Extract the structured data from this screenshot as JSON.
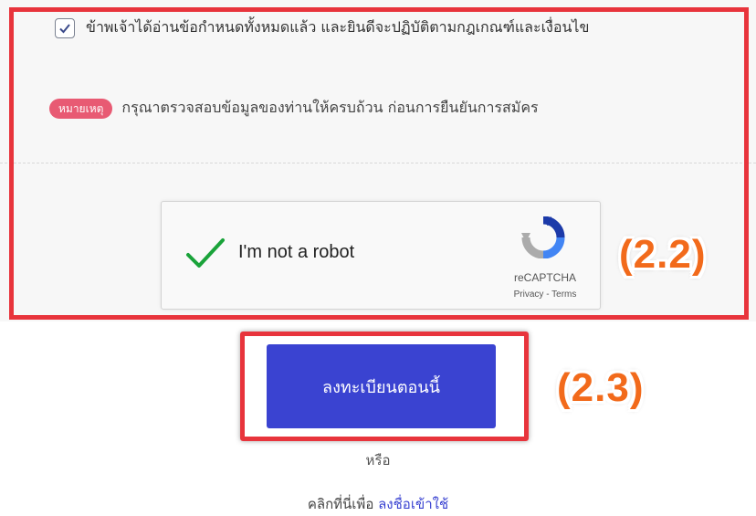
{
  "consent": {
    "checked": true,
    "label": "ข้าพเจ้าได้อ่านข้อกำหนดทั้งหมดแล้ว และยินดีจะปฏิบัติตามกฎเกณฑ์และเงื่อนไข"
  },
  "note": {
    "badge": "หมายเหตุ",
    "text": "กรุณาตรวจสอบข้อมูลของท่านให้ครบถ้วน ก่อนการยืนยันการสมัคร"
  },
  "captcha": {
    "label": "I'm not a robot",
    "brand": "reCAPTCHA",
    "privacy": "Privacy",
    "separator": " - ",
    "terms": "Terms"
  },
  "annotations": {
    "step_22": "(2.2)",
    "step_23": "(2.3)",
    "highlight_color": "#e8343c",
    "callout_color": "#f26a1b"
  },
  "register": {
    "button_label": "ลงทะเบียนตอนนี้",
    "color": "#3a43d1"
  },
  "footer": {
    "or_text": "หรือ",
    "prompt": "คลิกที่นี่เพื่อ ",
    "login_link": "ลงชื่อเข้าใช้"
  }
}
